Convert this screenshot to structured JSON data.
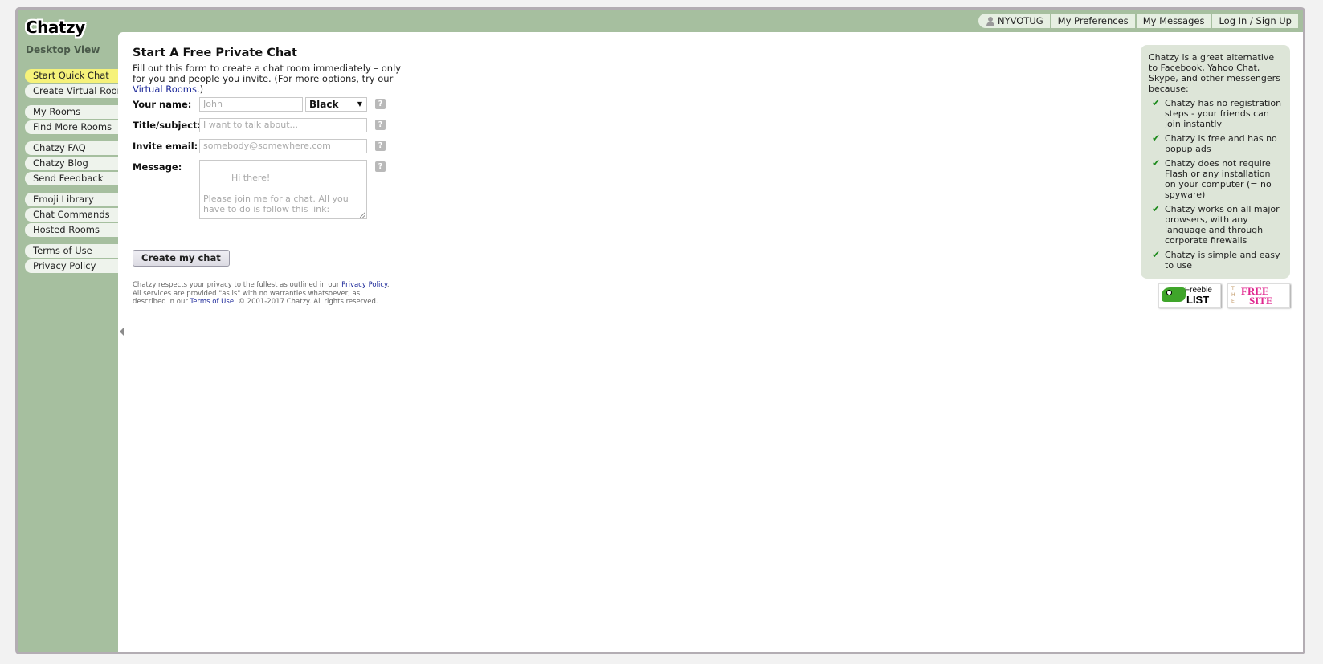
{
  "app": {
    "logo": "Chatzy",
    "view_label": "Desktop View"
  },
  "sidebar": {
    "groups": [
      {
        "items": [
          {
            "label": "Start Quick Chat",
            "active": true
          },
          {
            "label": "Create Virtual Room"
          }
        ]
      },
      {
        "items": [
          {
            "label": "My Rooms"
          },
          {
            "label": "Find More Rooms"
          }
        ]
      },
      {
        "items": [
          {
            "label": "Chatzy FAQ"
          },
          {
            "label": "Chatzy Blog"
          },
          {
            "label": "Send Feedback"
          }
        ]
      },
      {
        "items": [
          {
            "label": "Emoji Library"
          },
          {
            "label": "Chat Commands"
          },
          {
            "label": "Hosted Rooms"
          }
        ]
      },
      {
        "items": [
          {
            "label": "Terms of Use"
          },
          {
            "label": "Privacy Policy"
          }
        ]
      }
    ]
  },
  "topnav": {
    "username": "NYVOTUG",
    "preferences": "My Preferences",
    "messages": "My Messages",
    "login": "Log In / Sign Up"
  },
  "main": {
    "title": "Start A Free Private Chat",
    "intro_text": "Fill out this form to create a chat room immediately – only for you and people you invite. (For more options, try our ",
    "intro_link": "Virtual Rooms",
    "intro_end": ".)",
    "form": {
      "name_label": "Your name:",
      "name_placeholder": "John",
      "color_value": "Black",
      "subject_label": "Title/subject:",
      "subject_placeholder": "I want to talk about...",
      "email_label": "Invite email:",
      "email_placeholder": "somebody@somewhere.com",
      "message_label": "Message:",
      "message_placeholder": "Hi there!\n\nPlease join me for a chat. All you have to do is follow this link:",
      "help_glyph": "?",
      "submit_label": "Create my chat"
    },
    "disclaimer": {
      "part1": "Chatzy respects your privacy to the fullest as outlined in our ",
      "privacy_link": "Privacy Policy",
      "part2": ". All services are provided \"as is\" with no warranties whatsoever, as described in our ",
      "terms_link": "Terms of Use",
      "part3": ". © 2001-2017 Chatzy. All rights reserved."
    }
  },
  "promo": {
    "intro": "Chatzy is a great alternative to Facebook, Yahoo Chat, Skype, and other messengers because:",
    "items": [
      "Chatzy has no registration steps - your friends can join instantly",
      "Chatzy is free and has no popup ads",
      "Chatzy does not require Flash or any installation on your computer (= no spyware)",
      "Chatzy works on all major browsers, with any language and through corporate firewalls",
      "Chatzy is simple and easy to use"
    ],
    "check_glyph": "✔"
  },
  "badges": {
    "freebie_line1": "Freebie",
    "freebie_line2": "LIST",
    "free_the": "THE",
    "free_line1": "FREE",
    "free_line2": "SITE"
  }
}
